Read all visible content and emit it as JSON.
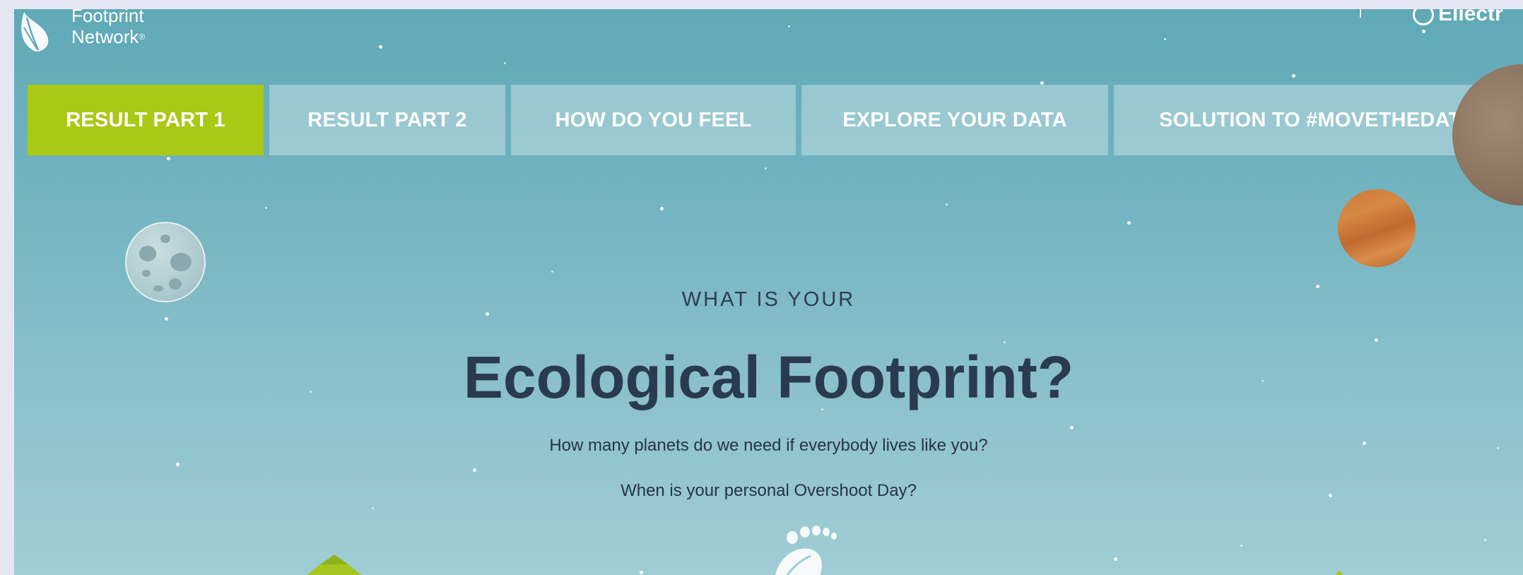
{
  "header": {
    "logo_line1": "Footprint",
    "logo_line2": "Network",
    "logo_reg": "®",
    "lang_partial": "Eliectr"
  },
  "tabs": [
    {
      "label": "RESULT PART 1",
      "active": true
    },
    {
      "label": "RESULT PART 2",
      "active": false
    },
    {
      "label": "HOW DO YOU FEEL",
      "active": false
    },
    {
      "label": "EXPLORE YOUR DATA",
      "active": false
    },
    {
      "label": "SOLUTION TO #MOVETHEDATE",
      "active": false
    }
  ],
  "hero": {
    "overline": "WHAT IS YOUR",
    "title": "Ecological Footprint?",
    "question1": "How many planets do we need if everybody lives like you?",
    "question2": "When is your personal Overshoot Day?"
  },
  "colors": {
    "active_tab": "#a9c914",
    "text_dark": "#2a3a4f",
    "sky_top": "#5fa9b6",
    "sky_bottom": "#a0cdd5"
  },
  "icons": [
    "leaf-logo-icon",
    "globe-icon",
    "footprint-leaf-icon",
    "moon-icon",
    "planet-icon"
  ]
}
